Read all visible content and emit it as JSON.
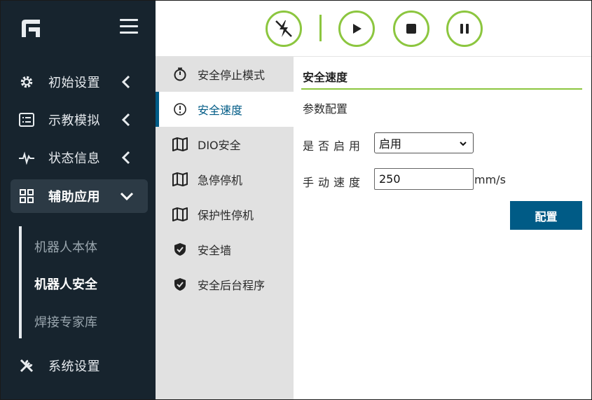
{
  "sidebar": {
    "items": [
      {
        "label": "初始设置",
        "icon": "gear-icon"
      },
      {
        "label": "示教模拟",
        "icon": "list-icon"
      },
      {
        "label": "状态信息",
        "icon": "pulse-icon"
      },
      {
        "label": "辅助应用",
        "icon": "grid-icon"
      },
      {
        "label": "系统设置",
        "icon": "tools-icon"
      }
    ],
    "subitems": [
      {
        "label": "机器人本体"
      },
      {
        "label": "机器人安全"
      },
      {
        "label": "焊接专家库"
      }
    ]
  },
  "toolbar": {
    "buttons": [
      "power-off-icon",
      "play-icon",
      "stop-icon",
      "pause-icon"
    ]
  },
  "menu": {
    "items": [
      {
        "label": "安全停止模式",
        "icon": "stopwatch-icon"
      },
      {
        "label": "安全速度",
        "icon": "info-icon"
      },
      {
        "label": "DIO安全",
        "icon": "map-icon"
      },
      {
        "label": "急停停机",
        "icon": "map-icon"
      },
      {
        "label": "保护性停机",
        "icon": "map-icon"
      },
      {
        "label": "安全墙",
        "icon": "shield-icon"
      },
      {
        "label": "安全后台程序",
        "icon": "shield-icon"
      }
    ]
  },
  "content": {
    "title": "安全速度",
    "subtitle": "参数配置",
    "enable_label": "是否启用",
    "enable_value": "启用",
    "speed_label": "手动速度",
    "speed_value": "250",
    "speed_unit": "mm/s",
    "config_button": "配置"
  },
  "colors": {
    "sidebar_bg": "#17242e",
    "accent_green": "#8cc63f",
    "accent_blue": "#005b86",
    "submenu_bg": "#e1e1e1"
  }
}
